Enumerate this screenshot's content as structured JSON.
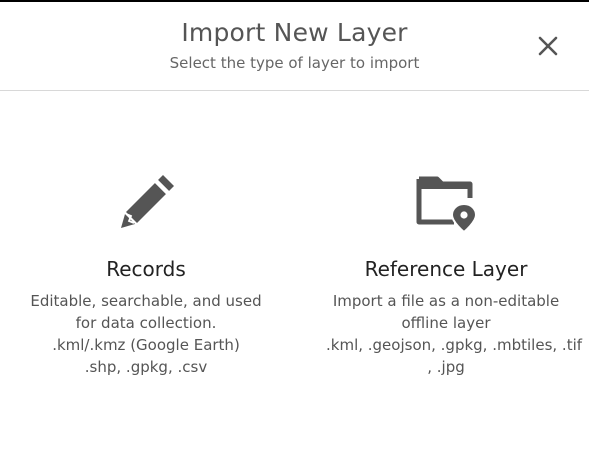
{
  "header": {
    "title": "Import New Layer",
    "subtitle": "Select the type of layer to import"
  },
  "icons": {
    "close": "close-icon",
    "records": "pencil-icon",
    "reference": "folder-location-icon"
  },
  "colors": {
    "icon": "#555555",
    "divider": "#d8d8d8"
  },
  "options": [
    {
      "heading": "Records",
      "lines": [
        "Editable, searchable, and used",
        "for data collection.",
        ".kml/.kmz (Google Earth)",
        ".shp, .gpkg, .csv"
      ]
    },
    {
      "heading": "Reference Layer",
      "lines": [
        "Import a file as a non-editable",
        "offline layer",
        ".kml, .geojson, .gpkg, .mbtiles, .tif",
        ", .jpg"
      ]
    }
  ]
}
